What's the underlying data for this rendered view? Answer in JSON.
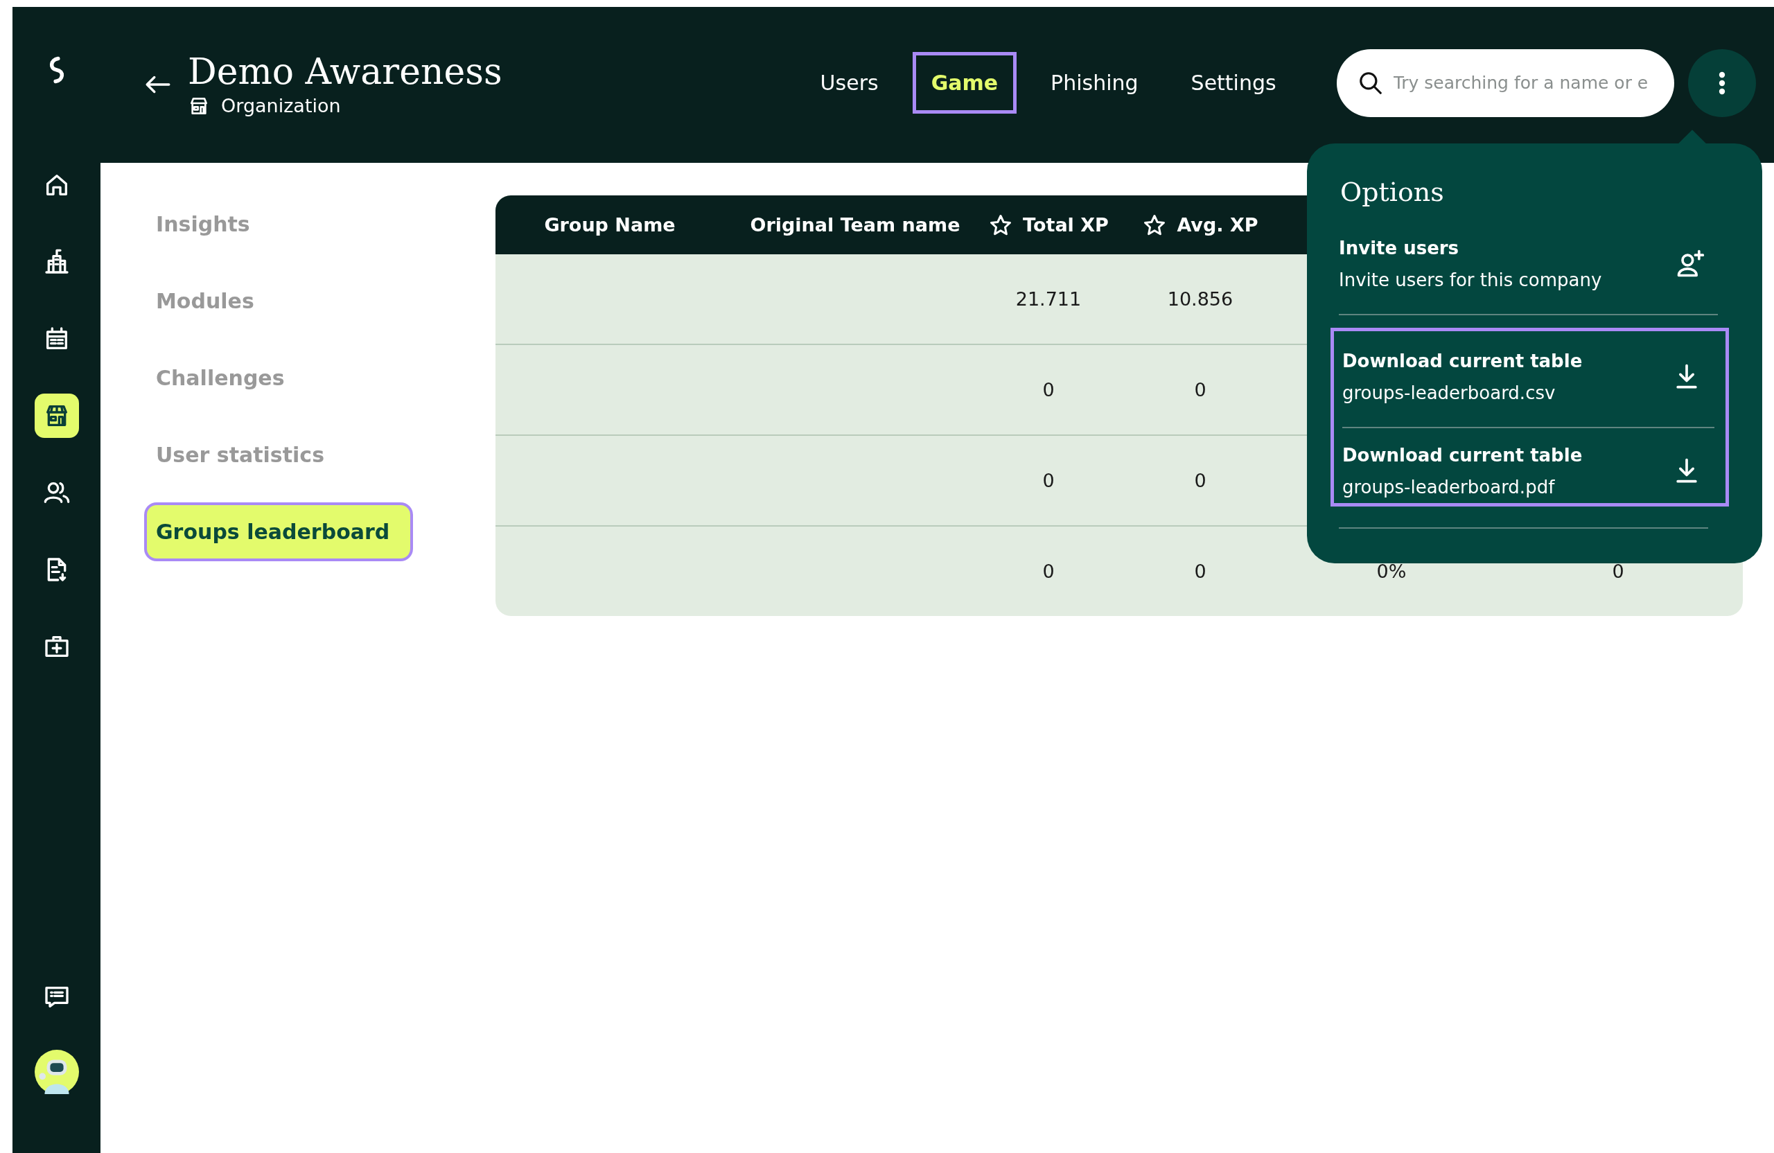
{
  "header": {
    "title": "Demo Awareness",
    "subtitle": "Organization"
  },
  "sidebar": {
    "items": [
      {
        "kind": "home",
        "selected": false
      },
      {
        "kind": "building",
        "selected": false
      },
      {
        "kind": "calendar",
        "selected": false
      },
      {
        "kind": "store",
        "selected": true
      },
      {
        "kind": "users",
        "selected": false
      },
      {
        "kind": "report",
        "selected": false
      },
      {
        "kind": "kit",
        "selected": false
      }
    ]
  },
  "tabs": [
    {
      "label": "Users",
      "selected": false,
      "highlighted": false
    },
    {
      "label": "Game",
      "selected": true,
      "highlighted": true
    },
    {
      "label": "Phishing",
      "selected": false,
      "highlighted": false
    },
    {
      "label": "Settings",
      "selected": false,
      "highlighted": false
    }
  ],
  "search": {
    "placeholder": "Try searching for a name or e"
  },
  "subnav": [
    {
      "label": "Insights",
      "selected": false,
      "highlighted": false
    },
    {
      "label": "Modules",
      "selected": false,
      "highlighted": false
    },
    {
      "label": "Challenges",
      "selected": false,
      "highlighted": false
    },
    {
      "label": "User statistics",
      "selected": false,
      "highlighted": false
    },
    {
      "label": "Groups leaderboard",
      "selected": true,
      "highlighted": true
    }
  ],
  "table": {
    "columns": [
      {
        "label": "Group Name",
        "kind": "plain"
      },
      {
        "label": "Original Team name",
        "kind": "plain"
      },
      {
        "label": "Total XP",
        "kind": "star"
      },
      {
        "label": "Avg. XP",
        "kind": "star"
      }
    ],
    "rows": [
      {
        "total_xp": "21.711",
        "avg_xp": "10.856"
      },
      {
        "total_xp": "0",
        "avg_xp": "0"
      },
      {
        "total_xp": "0",
        "avg_xp": "0"
      },
      {
        "total_xp": "0",
        "avg_xp": "0",
        "column_5": "0%",
        "column_6": "0"
      }
    ]
  },
  "options_menu": {
    "title": "Options",
    "items": [
      {
        "kind": "invite",
        "title": "Invite users",
        "subtitle": "Invite users for this company",
        "highlighted": false
      },
      {
        "kind": "download",
        "title": "Download current table",
        "subtitle": "groups-leaderboard.csv",
        "highlighted": true
      },
      {
        "kind": "download",
        "title": "Download current table",
        "subtitle": "groups-leaderboard.pdf",
        "highlighted": true
      }
    ]
  }
}
